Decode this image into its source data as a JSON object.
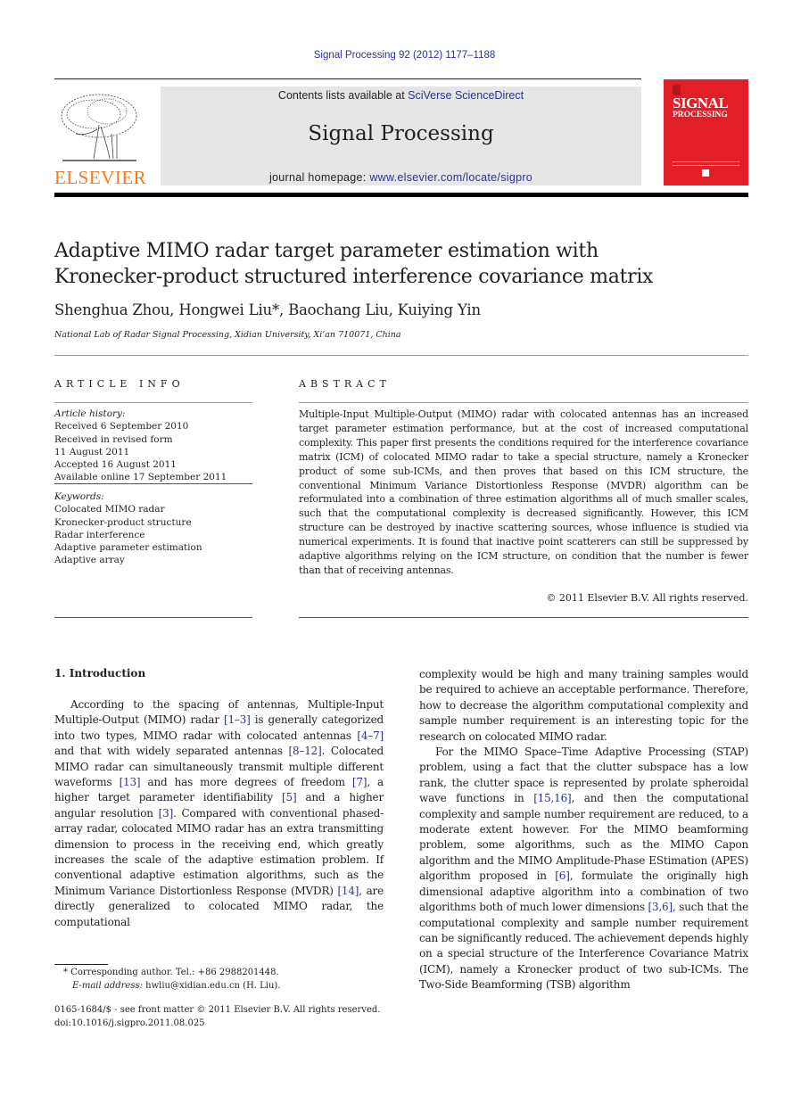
{
  "header": {
    "citation": "Signal Processing 92 (2012) 1177–1188",
    "publisher_name": "ELSEVIER",
    "contents_prefix": "Contents lists available at ",
    "contents_link": "SciVerse ScienceDirect",
    "journal_title": "Signal Processing",
    "homepage_prefix": "journal homepage: ",
    "homepage_link": "www.elsevier.com/locate/sigpro",
    "cover_line1": "SIGNAL",
    "cover_line2": "PROCESSING",
    "colors": {
      "link": "#2e3192",
      "elsevier_orange": "#f47b20",
      "cover_red": "#e21f26",
      "banner_gray": "#e6e6e6"
    }
  },
  "article": {
    "title_line1": "Adaptive MIMO radar target parameter estimation with",
    "title_line2": "Kronecker-product structured interference covariance matrix",
    "authors": "Shenghua Zhou, Hongwei Liu*, Baochang Liu, Kuiying Yin",
    "affiliation": "National Lab of Radar Signal Processing, Xidian University, Xi’an 710071, China"
  },
  "article_info": {
    "heading": "ARTICLE INFO",
    "history_label": "Article history:",
    "history": [
      "Received 6 September 2010",
      "Received in revised form",
      "11 August 2011",
      "Accepted 16 August 2011",
      "Available online 17 September 2011"
    ],
    "keywords_label": "Keywords:",
    "keywords": [
      "Colocated MIMO radar",
      "Kronecker-product structure",
      "Radar interference",
      "Adaptive parameter estimation",
      "Adaptive array"
    ]
  },
  "abstract": {
    "heading": "ABSTRACT",
    "text": "Multiple-Input Multiple-Output (MIMO) radar with colocated antennas has an increased target parameter estimation performance, but at the cost of increased computational complexity. This paper first presents the conditions required for the interference covariance matrix (ICM) of colocated MIMO radar to take a special structure, namely a Kronecker product of some sub-ICMs, and then proves that based on this ICM structure, the conventional Minimum Variance Distortionless Response (MVDR) algorithm can be reformulated into a combination of three estimation algorithms all of much smaller scales, such that the computational complexity is decreased significantly. However, this ICM structure can be destroyed by inactive scattering sources, whose influence is studied via numerical experiments. It is found that inactive point scatterers can still be suppressed by adaptive algorithms relying on the ICM structure, on condition that the number is fewer than that of receiving antennas.",
    "copyright": "© 2011 Elsevier B.V. All rights reserved."
  },
  "introduction": {
    "heading": "1.   Introduction",
    "left_paragraph": [
      {
        "t": "According to the spacing of antennas, Multiple-Input Multiple-Output (MIMO) radar "
      },
      {
        "ref": "[1–3]"
      },
      {
        "t": " is generally categorized into two types, MIMO radar with colocated antennas "
      },
      {
        "ref": "[4–7]"
      },
      {
        "t": " and that with widely separated antennas "
      },
      {
        "ref": "[8–12]"
      },
      {
        "t": ". Colocated MIMO radar can simultaneously transmit multiple different waveforms "
      },
      {
        "ref": "[13]"
      },
      {
        "t": " and has more degrees of freedom "
      },
      {
        "ref": "[7]"
      },
      {
        "t": ", a higher target parameter identifiability "
      },
      {
        "ref": "[5]"
      },
      {
        "t": " and a higher angular resolution "
      },
      {
        "ref": "[3]"
      },
      {
        "t": ". Compared with conventional phased-array radar, colocated MIMO radar has an extra transmitting dimension to process in the receiving end, which greatly increases the scale of the adaptive estimation problem. If conventional adaptive estimation algorithms, such as the Minimum Variance Distortionless Response (MVDR) "
      },
      {
        "ref": "[14]"
      },
      {
        "t": ", are directly generalized to colocated MIMO radar, the computational"
      }
    ],
    "right_paragraph_1": "complexity would be high and many training samples would be required to achieve an acceptable performance. Therefore, how to decrease the algorithm computational complexity and sample number requirement is an interesting topic for the research on colocated MIMO radar.",
    "right_paragraph_2": [
      {
        "t": "For the MIMO Space–Time Adaptive Processing (STAP) problem, using a fact that the clutter subspace has a low rank, the clutter space is represented by prolate spheroidal wave functions in "
      },
      {
        "ref": "[15,16]"
      },
      {
        "t": ", and then the computational complexity and sample number requirement are reduced, to a moderate extent however. For the MIMO beamforming problem, some algorithms, such as the MIMO Capon algorithm and the MIMO Amplitude-Phase EStimation (APES) algorithm proposed in "
      },
      {
        "ref": "[6]"
      },
      {
        "t": ", formulate the originally high dimensional adaptive algorithm into a combination of two algorithms both of much lower dimensions "
      },
      {
        "ref": "[3,6]"
      },
      {
        "t": ", such that the computational complexity and sample number requirement can be significantly reduced. The achievement depends highly on a special structure of the Interference Covariance Matrix (ICM), namely a Kronecker product of two sub-ICMs. The Two-Side Beamforming (TSB) algorithm"
      }
    ]
  },
  "footnotes": {
    "corresponding": "* Corresponding author. Tel.: +86 2988201448.",
    "email_label": "E-mail address:",
    "email_value": " hwliu@xidian.edu.cn (H. Liu).",
    "front_matter": "0165-1684/$ - see front matter © 2011 Elsevier B.V. All rights reserved.",
    "doi": "doi:10.1016/j.sigpro.2011.08.025"
  }
}
